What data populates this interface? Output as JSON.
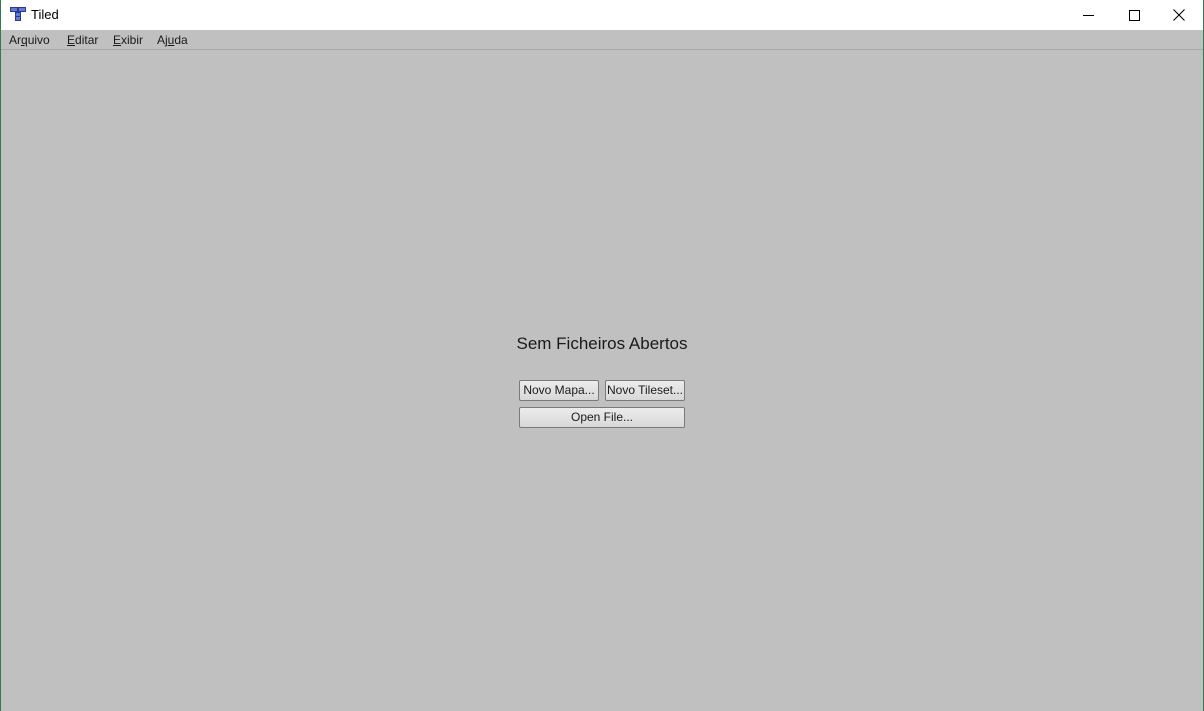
{
  "window": {
    "title": "Tiled",
    "app_icon": "tiled-logo-icon",
    "controls": {
      "minimize": "minimize-icon",
      "maximize": "maximize-icon",
      "close": "close-icon"
    }
  },
  "menubar": {
    "items": [
      {
        "pre": "Ar",
        "mnemonic": "q",
        "post": "uivo"
      },
      {
        "pre": "",
        "mnemonic": "E",
        "post": "ditar"
      },
      {
        "pre": "",
        "mnemonic": "E",
        "post": "xibir"
      },
      {
        "pre": "Aj",
        "mnemonic": "u",
        "post": "da"
      }
    ]
  },
  "main": {
    "empty_title": "Sem Ficheiros Abertos",
    "new_map_label": "Novo Mapa...",
    "new_tileset_label": "Novo Tileset...",
    "open_file_label": "Open File..."
  },
  "colors": {
    "background": "#c0c0c0",
    "titlebar": "#ffffff",
    "window_border": "#2e7d4f"
  }
}
